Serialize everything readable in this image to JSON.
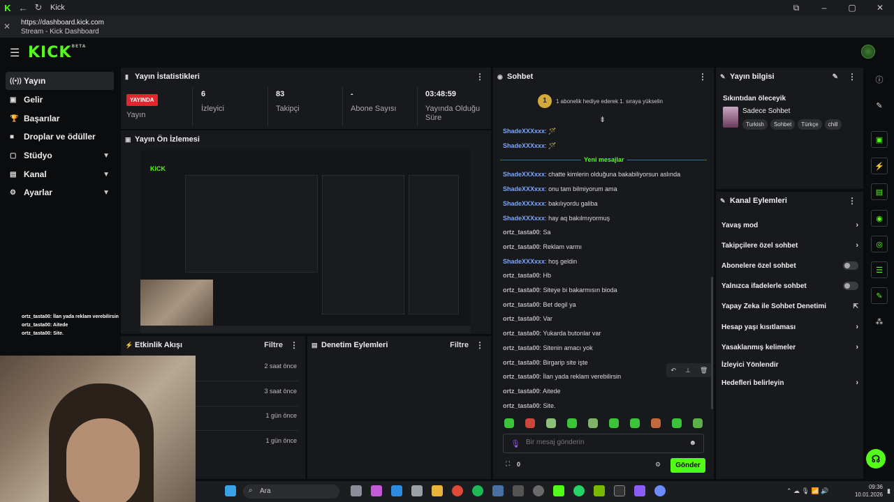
{
  "browser": {
    "tab_title": "Kick",
    "url": "https://dashboard.kick.com",
    "page_title": "Stream - Kick Dashboard"
  },
  "app": {
    "logo": "KICK",
    "logo_sup": "BETA"
  },
  "sidebar": {
    "items": [
      {
        "label": "Yayın",
        "icon": "broadcast-icon"
      },
      {
        "label": "Gelir",
        "icon": "money-icon"
      },
      {
        "label": "Başarılar",
        "icon": "trophy-icon"
      },
      {
        "label": "Droplar ve ödüller",
        "icon": "gift-icon"
      },
      {
        "label": "Stüdyo",
        "icon": "studio-icon"
      },
      {
        "label": "Kanal",
        "icon": "channel-icon"
      },
      {
        "label": "Ayarlar",
        "icon": "gear-icon"
      }
    ]
  },
  "stats": {
    "title": "Yayın İstatistikleri",
    "live_badge": "YAYINDA",
    "live_label": "Yayın",
    "viewers_value": "6",
    "viewers_label": "İzleyici",
    "followers_value": "83",
    "followers_label": "Takipçi",
    "subs_value": "-",
    "subs_label": "Abone Sayısı",
    "uptime_value": "03:48:59",
    "uptime_label": "Yayında Olduğu Süre"
  },
  "preview": {
    "title": "Yayın Ön İzlemesi"
  },
  "activity": {
    "title": "Etkinlik Akışı",
    "filter": "Filtre",
    "times": [
      "2 saat önce",
      "3 saat önce",
      "1 gün önce",
      "1 gün önce"
    ]
  },
  "moderation": {
    "title": "Denetim Eylemleri",
    "filter": "Filtre"
  },
  "chat": {
    "title": "Sohbet",
    "gift_count": "1",
    "gift_text": "1 abonelik hediye ederek 1. sıraya yükselin",
    "new_messages": "Yeni mesajlar",
    "messages": [
      {
        "user": "ShadeXXXxxx",
        "text": "🪄",
        "color": "blue"
      },
      {
        "user": "ShadeXXXxxx",
        "text": "🪄",
        "color": "blue"
      },
      {
        "user": "ShadeXXXxxx",
        "text": "chatte kimlerin olduğuna bakabiliyorsun aslında",
        "color": "blue"
      },
      {
        "user": "ShadeXXXxxx",
        "text": "onu tam bilmiyorum ama",
        "color": "blue"
      },
      {
        "user": "ShadeXXXxxx",
        "text": "bakılıyordu galiba",
        "color": "blue"
      },
      {
        "user": "ShadeXXXxxx",
        "text": "hay aq bakılmıyormuş",
        "color": "blue"
      },
      {
        "user": "ortz_tasta00",
        "text": "Sa",
        "color": "gray"
      },
      {
        "user": "ortz_tasta00",
        "text": "Reklam varmı",
        "color": "gray"
      },
      {
        "user": "ShadeXXXxxx",
        "text": "hoş geldin",
        "color": "blue"
      },
      {
        "user": "ortz_tasta00",
        "text": "Hb",
        "color": "gray"
      },
      {
        "user": "ortz_tasta00",
        "text": "Siteye bi bakarmısın bioda",
        "color": "gray"
      },
      {
        "user": "ortz_tasta00",
        "text": "Bet degil ya",
        "color": "gray"
      },
      {
        "user": "ortz_tasta00",
        "text": "Var",
        "color": "gray"
      },
      {
        "user": "ortz_tasta00",
        "text": "Yukarda butonlar var",
        "color": "gray"
      },
      {
        "user": "ortz_tasta00",
        "text": "Sitenin amacı yok",
        "color": "gray"
      },
      {
        "user": "ortz_tasta00",
        "text": "Birgarip site işte",
        "color": "gray"
      },
      {
        "user": "ortz_tasta00",
        "text": "İlan yada reklam verebilirsin",
        "color": "gray"
      },
      {
        "user": "ortz_tasta00",
        "text": "Aitede",
        "color": "gray"
      },
      {
        "user": "ortz_tasta00",
        "text": "Site.",
        "color": "gray"
      }
    ],
    "input_placeholder": "Bir mesaj gönderin",
    "points": "0",
    "send_label": "Gönder"
  },
  "stream_info": {
    "title": "Yayın bilgisi",
    "stream_title": "Sıkıntıdan öleceyik",
    "category": "Sadece Sohbet",
    "tags": [
      "Turkish",
      "Sohbet",
      "Türkçe",
      "chill"
    ]
  },
  "channel_actions": {
    "title": "Kanal Eylemleri",
    "items": [
      {
        "label": "Yavaş mod",
        "kind": "chevron"
      },
      {
        "label": "Takipçilere özel sohbet",
        "kind": "chevron"
      },
      {
        "label": "Abonelere özel sohbet",
        "kind": "toggle"
      },
      {
        "label": "Yalnızca ifadelerle sohbet",
        "kind": "toggle"
      },
      {
        "label": "Yapay Zeka ile Sohbet Denetimi",
        "kind": "external"
      },
      {
        "label": "Hesap yaşı kısıtlaması",
        "kind": "chevron"
      },
      {
        "label": "Yasaklanmış kelimeler",
        "kind": "chevron"
      },
      {
        "label": "İzleyici Yönlendir",
        "kind": "none"
      },
      {
        "label": "Hedefleri belirleyin",
        "kind": "chevron"
      }
    ]
  },
  "overlay_chat": [
    {
      "user": "ortz_tasta00",
      "text": "İlan yada reklam verebilirsin"
    },
    {
      "user": "ortz_tasta00",
      "text": "Aitede"
    },
    {
      "user": "ortz_tasta00",
      "text": "Site."
    }
  ],
  "taskbar": {
    "search": "Ara",
    "time": "09:36",
    "date": "10.01.2026"
  },
  "colors": {
    "accent": "#53fc18",
    "live": "#e3252d",
    "username_blue": "#7aa7ff"
  }
}
